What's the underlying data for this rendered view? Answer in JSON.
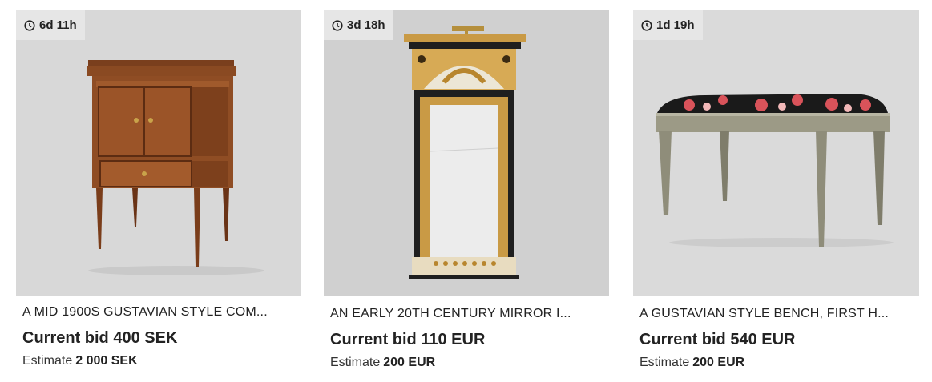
{
  "listings": [
    {
      "timer": "6d 11h",
      "title": "A MID 1900S GUSTAVIAN STYLE COM...",
      "bid_label": "Current bid",
      "bid_value": "400 SEK",
      "estimate_label": "Estimate",
      "estimate_value": "2 000 SEK",
      "image_icon": "bedside-cabinet-photo"
    },
    {
      "timer": "3d 18h",
      "title": "AN EARLY 20TH CENTURY MIRROR I...",
      "bid_label": "Current bid",
      "bid_value": "110 EUR",
      "estimate_label": "Estimate",
      "estimate_value": "200 EUR",
      "image_icon": "gilt-mirror-photo"
    },
    {
      "timer": "1d 19h",
      "title": "A GUSTAVIAN STYLE BENCH, FIRST H...",
      "bid_label": "Current bid",
      "bid_value": "540 EUR",
      "estimate_label": "Estimate",
      "estimate_value": "200 EUR",
      "image_icon": "upholstered-bench-photo"
    }
  ]
}
